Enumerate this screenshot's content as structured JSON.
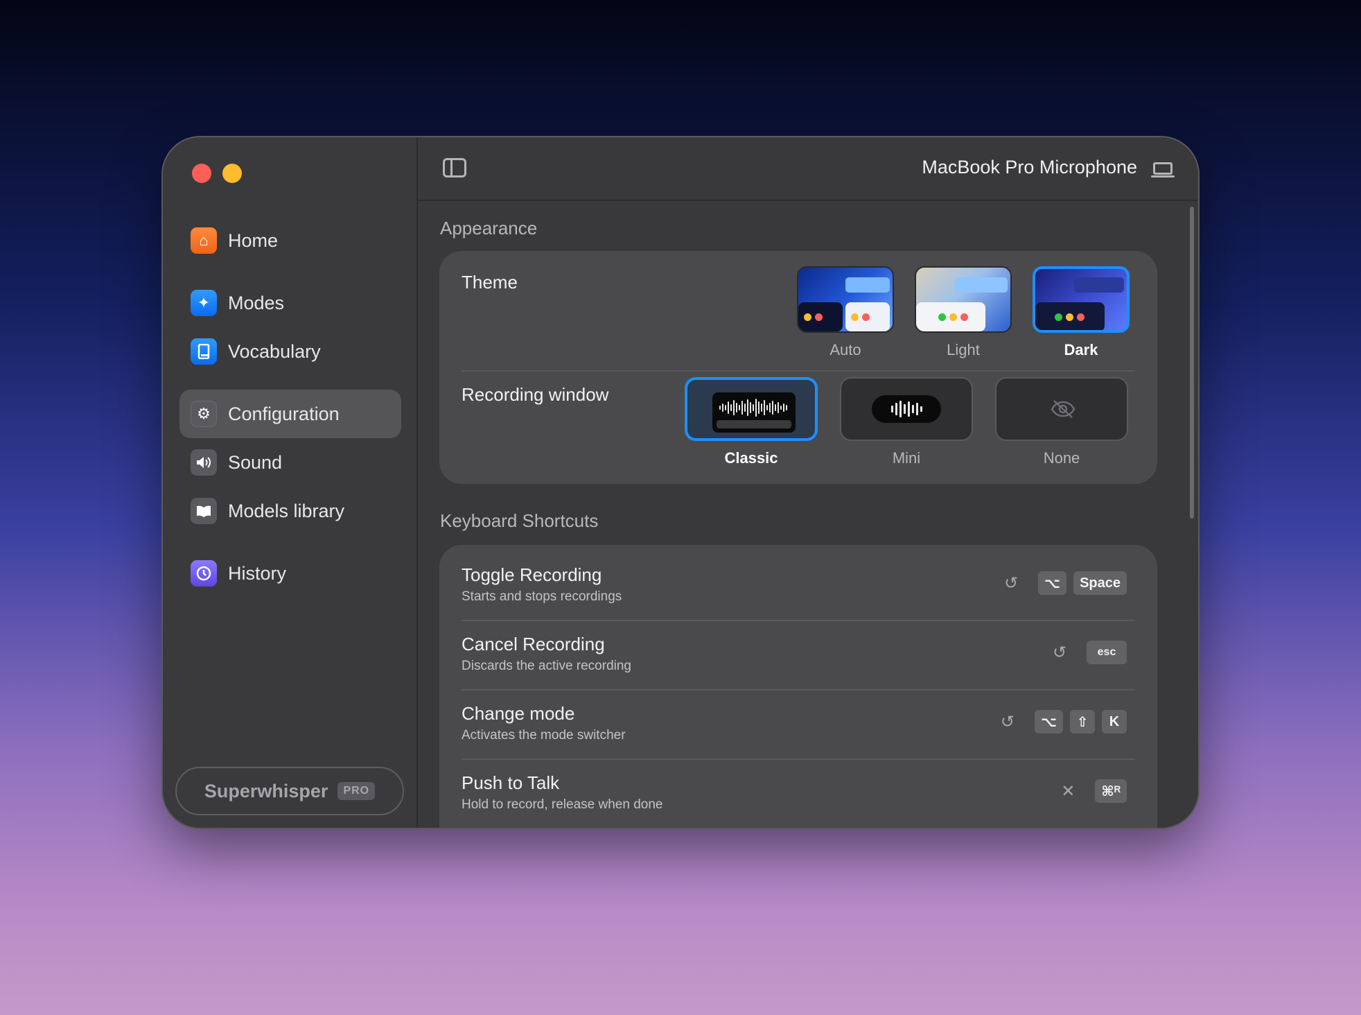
{
  "sidebar": {
    "items": [
      {
        "label": "Home",
        "icon": "house-icon"
      },
      {
        "label": "Modes",
        "icon": "sparkle-icon"
      },
      {
        "label": "Vocabulary",
        "icon": "book-icon"
      },
      {
        "label": "Configuration",
        "icon": "gear-icon"
      },
      {
        "label": "Sound",
        "icon": "speaker-icon"
      },
      {
        "label": "Models library",
        "icon": "open-book-icon"
      },
      {
        "label": "History",
        "icon": "history-icon"
      }
    ],
    "brand": "Superwhisper",
    "badge": "PRO"
  },
  "header": {
    "microphone": "MacBook Pro Microphone"
  },
  "appearance": {
    "title": "Appearance",
    "theme_label": "Theme",
    "themes": [
      {
        "label": "Auto",
        "selected": false
      },
      {
        "label": "Light",
        "selected": false
      },
      {
        "label": "Dark",
        "selected": true
      }
    ],
    "recording_label": "Recording window",
    "recording_options": [
      {
        "label": "Classic",
        "selected": true
      },
      {
        "label": "Mini",
        "selected": false
      },
      {
        "label": "None",
        "selected": false
      }
    ]
  },
  "shortcuts": {
    "title": "Keyboard Shortcuts",
    "items": [
      {
        "title": "Toggle Recording",
        "subtitle": "Starts and stops recordings",
        "action_icon": "reset-icon",
        "keys": [
          "⌥",
          "Space"
        ]
      },
      {
        "title": "Cancel Recording",
        "subtitle": "Discards the active recording",
        "action_icon": "reset-icon",
        "keys": [
          "esc"
        ]
      },
      {
        "title": "Change mode",
        "subtitle": "Activates the mode switcher",
        "action_icon": "reset-icon",
        "keys": [
          "⌥",
          "⇧",
          "K"
        ]
      },
      {
        "title": "Push to Talk",
        "subtitle": "Hold to record, release when done",
        "action_icon": "clear-icon",
        "keys": [
          "⌘ᴿ"
        ]
      }
    ]
  },
  "colors": {
    "accent": "#1e8fff",
    "close": "#ff5f57",
    "minimize": "#febc2e"
  }
}
